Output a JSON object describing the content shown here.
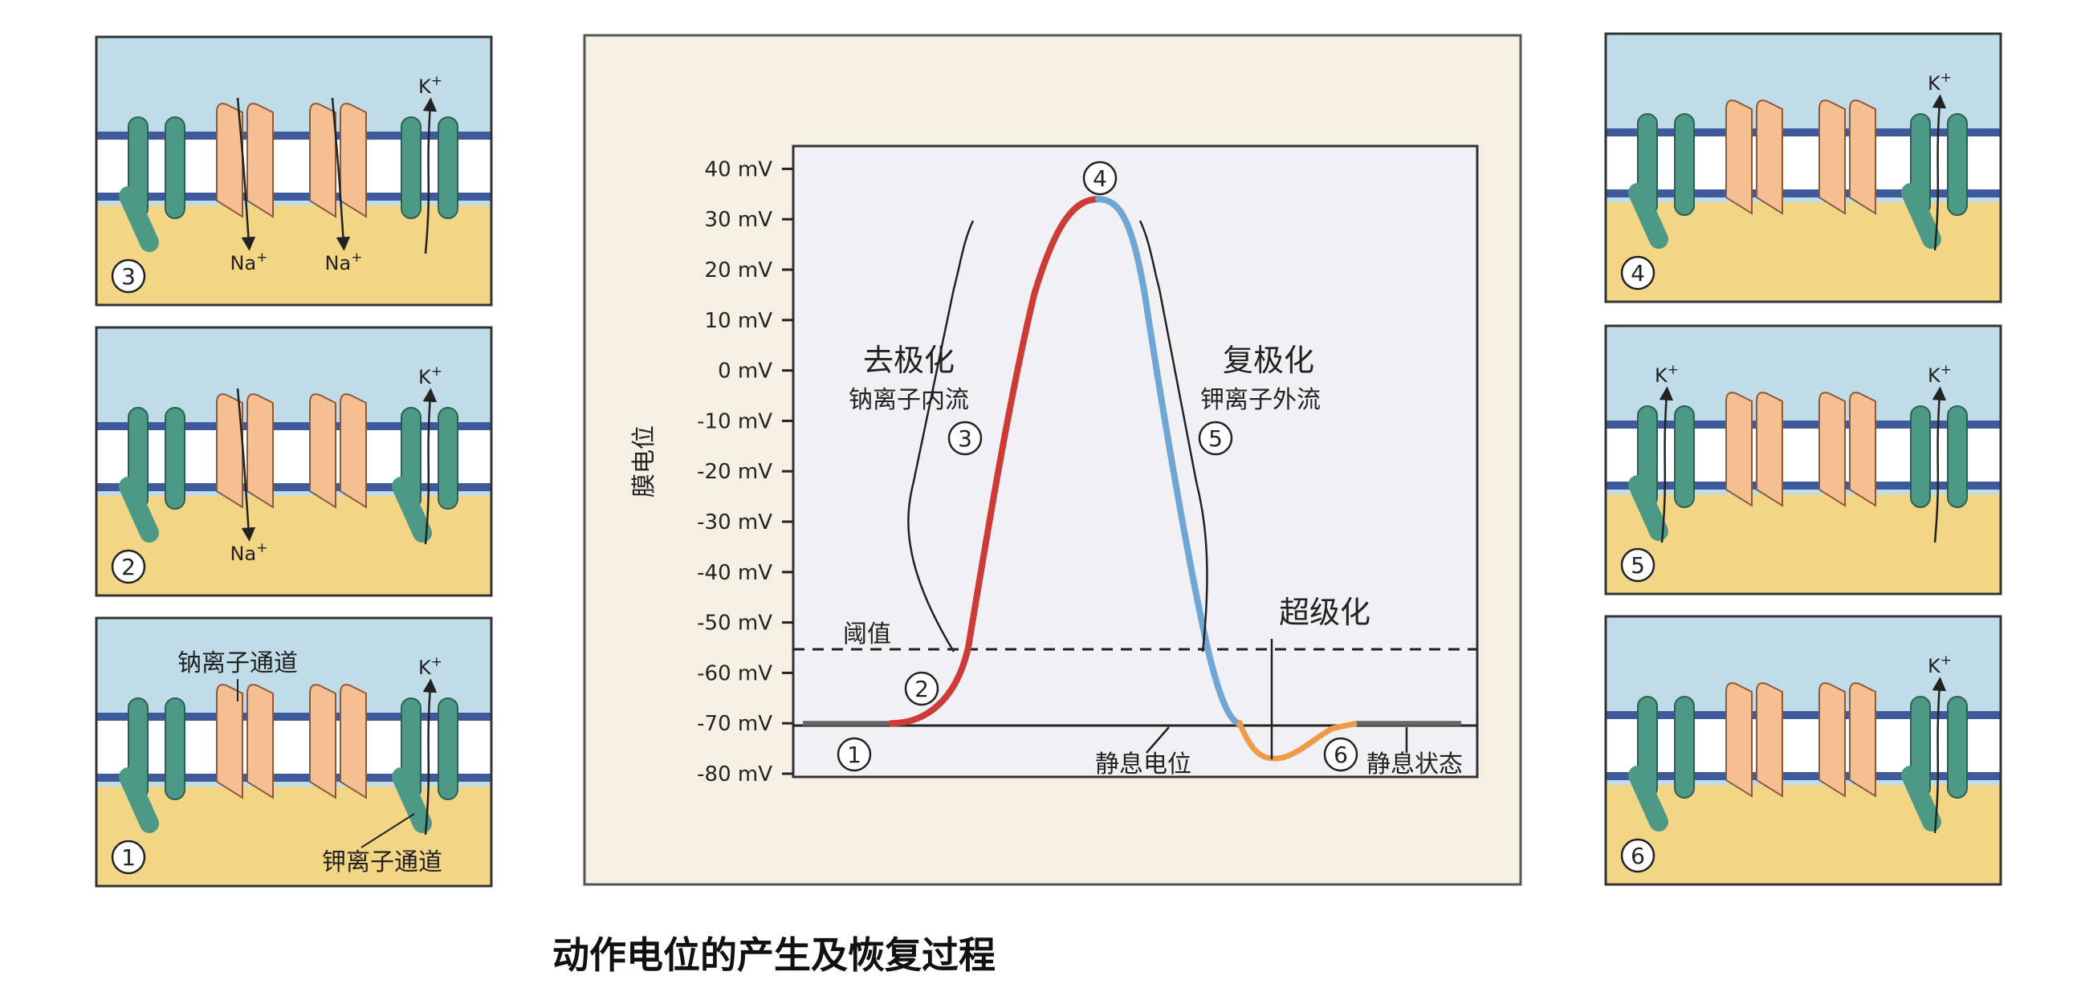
{
  "caption": "动作电位的产生及恢复过程",
  "colors": {
    "extracellular": "#bfdce8",
    "intracellular": "#f3d586",
    "membrane_line": "#3f5a9a",
    "k_channel": "#4c9a86",
    "na_channel": "#f6bf91",
    "depolarization_curve": "#cc3b35",
    "repolarization_curve": "#6fa6d6",
    "hyperpolarization_curve": "#ee9a47",
    "chart_background": "#f6efe4",
    "plot_background": "#f0f0f5"
  },
  "icons": [
    "membrane-icon",
    "potassium-channel-icon",
    "sodium-channel-icon",
    "ion-arrow-icon"
  ],
  "chart_data": {
    "type": "line",
    "ylabel": "膜电位",
    "yticks": [
      "40 mV",
      "30 mV",
      "20 mV",
      "10 mV",
      "0 mV",
      "-10 mV",
      "-20 mV",
      "-30 mV",
      "-40 mV",
      "-50 mV",
      "-60 mV",
      "-70 mV",
      "-80 mV"
    ],
    "ylim": [
      -80,
      40
    ],
    "threshold_mV": -55,
    "resting_mV": -70,
    "x_points": [
      0,
      1,
      2,
      3,
      4,
      5,
      6,
      7,
      8,
      9,
      10,
      11,
      12
    ],
    "series": [
      {
        "phase": "depolarization",
        "values": [
          -70,
          -69,
          -66,
          -60,
          -40,
          -10,
          20,
          34
        ]
      },
      {
        "phase": "repolarization",
        "values": [
          34,
          15,
          -20,
          -55,
          -70
        ]
      },
      {
        "phase": "hyperpolarization",
        "values": [
          -70,
          -77,
          -72,
          -70,
          -70
        ]
      }
    ],
    "annotations": {
      "threshold": "阈值",
      "depolarization": "去极化",
      "depolarization_sub": "钠离子内流",
      "repolarization": "复极化",
      "repolarization_sub": "钾离子外流",
      "hyperpolarization": "超级化",
      "resting_potential": "静息电位",
      "resting_state": "静息状态",
      "markers": [
        "1",
        "2",
        "3",
        "4",
        "5",
        "6"
      ]
    }
  },
  "panels": [
    {
      "number": "3",
      "labels": {
        "na1": "Na",
        "na2": "Na",
        "k": "K"
      }
    },
    {
      "number": "2",
      "labels": {
        "na1": "Na",
        "k": "K"
      }
    },
    {
      "number": "1",
      "labels": {
        "na_channel": "钠离子通道",
        "k_channel": "钾离子通道",
        "k": "K"
      }
    },
    {
      "number": "4",
      "labels": {
        "k": "K"
      }
    },
    {
      "number": "5",
      "labels": {
        "k1": "K",
        "k2": "K"
      }
    },
    {
      "number": "6",
      "labels": {
        "k": "K"
      }
    }
  ],
  "ion_charge": "+"
}
